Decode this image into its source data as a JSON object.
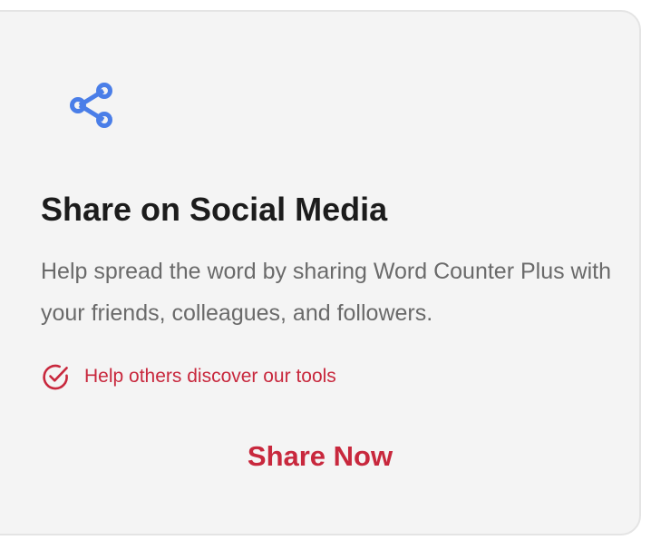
{
  "card": {
    "icon": "share-icon",
    "title": "Share on Social Media",
    "description": "Help spread the word by sharing Word Counter Plus with your friends, colleagues, and followers.",
    "feature": {
      "icon": "check-circle-icon",
      "text": "Help others discover our tools"
    },
    "button_label": "Share Now"
  },
  "colors": {
    "icon_blue": "#4a7ee8",
    "accent_red": "#c8283d",
    "title": "#1c1c1c",
    "body_text": "#6a6a6a",
    "card_bg": "#f4f4f4"
  }
}
